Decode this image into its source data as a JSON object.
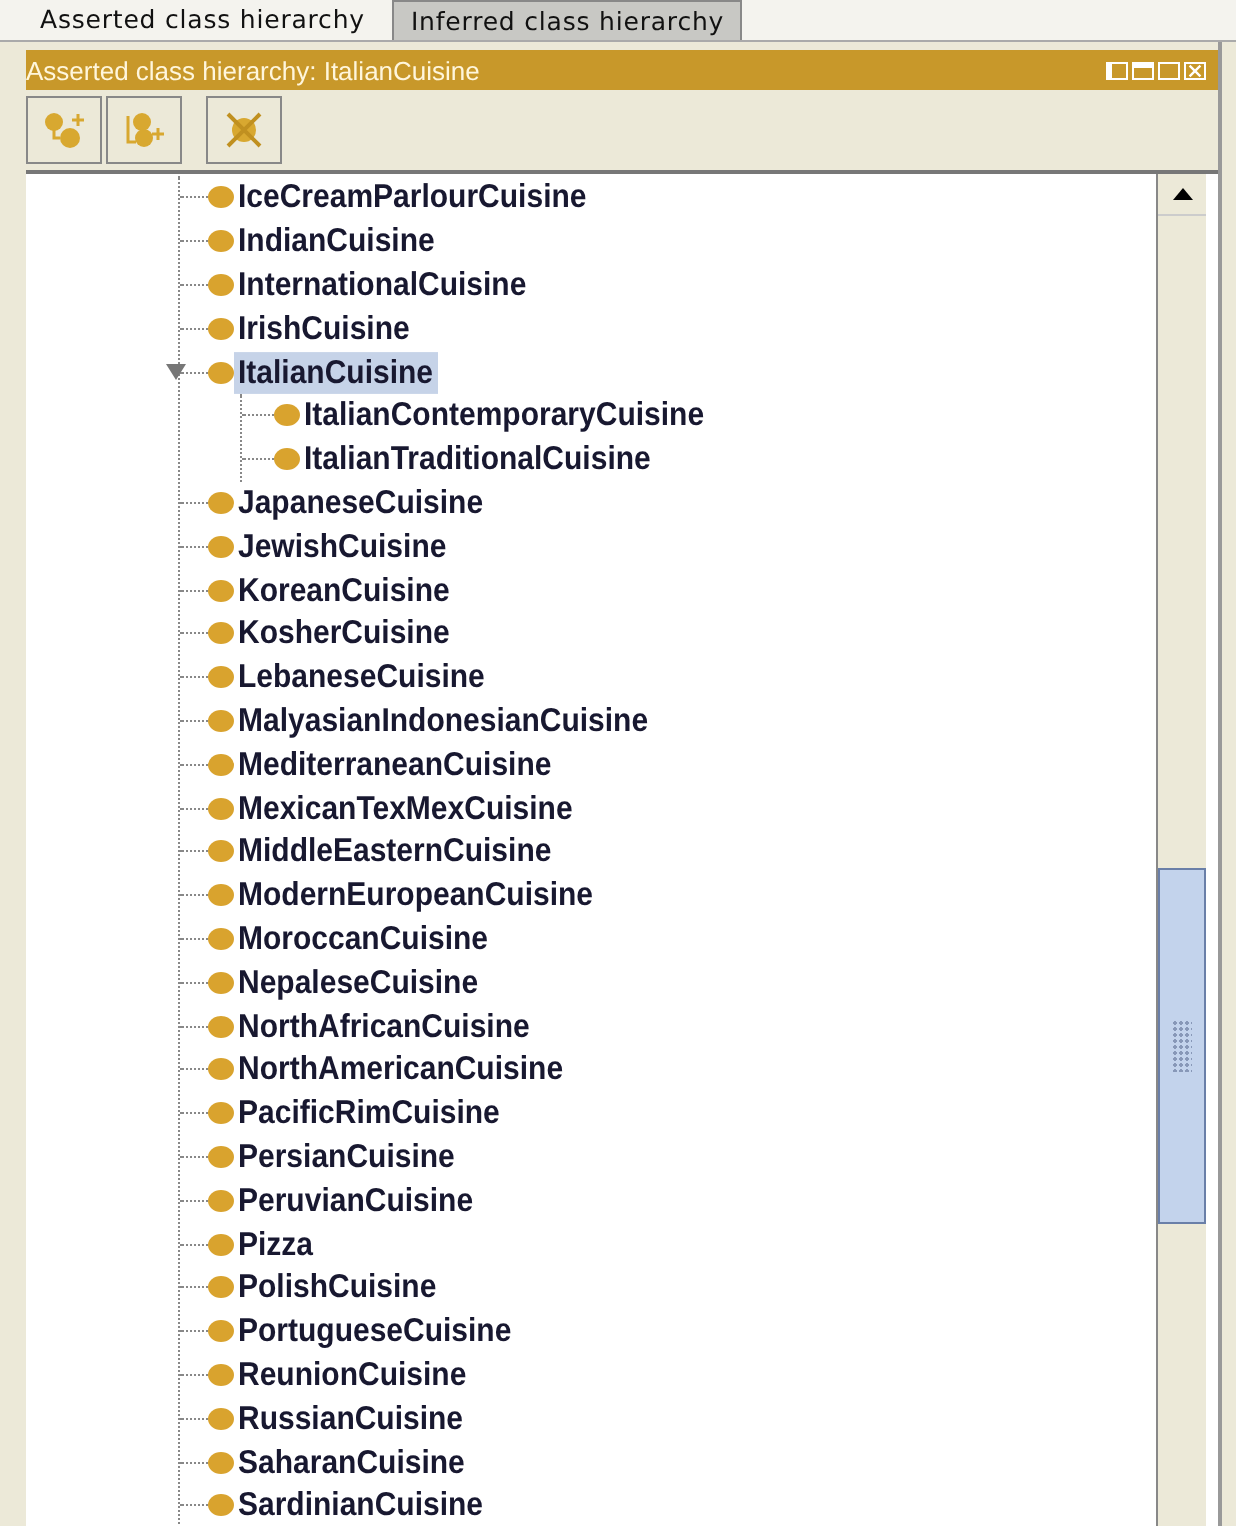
{
  "tabs": [
    {
      "label": "Asserted class hierarchy",
      "selected": true
    },
    {
      "label": "Inferred class hierarchy",
      "selected": false
    }
  ],
  "panel": {
    "title": "Asserted class hierarchy: ItalianCuisine"
  },
  "tree": [
    {
      "label": "IceCreamParlourCuisine",
      "selected": false
    },
    {
      "label": "IndianCuisine",
      "selected": false
    },
    {
      "label": "InternationalCuisine",
      "selected": false
    },
    {
      "label": "IrishCuisine",
      "selected": false
    },
    {
      "label": "ItalianCuisine",
      "selected": true,
      "expanded": true,
      "children": [
        {
          "label": "ItalianContemporaryCuisine",
          "selected": false
        },
        {
          "label": "ItalianTraditionalCuisine",
          "selected": false
        }
      ]
    },
    {
      "label": "JapaneseCuisine",
      "selected": false
    },
    {
      "label": "JewishCuisine",
      "selected": false
    },
    {
      "label": "KoreanCuisine",
      "selected": false
    },
    {
      "label": "KosherCuisine",
      "selected": false
    },
    {
      "label": "LebaneseCuisine",
      "selected": false
    },
    {
      "label": "MalyasianIndonesianCuisine",
      "selected": false
    },
    {
      "label": "MediterraneanCuisine",
      "selected": false
    },
    {
      "label": "MexicanTexMexCuisine",
      "selected": false
    },
    {
      "label": "MiddleEasternCuisine",
      "selected": false
    },
    {
      "label": "ModernEuropeanCuisine",
      "selected": false
    },
    {
      "label": "MoroccanCuisine",
      "selected": false
    },
    {
      "label": "NepaleseCuisine",
      "selected": false
    },
    {
      "label": "NorthAfricanCuisine",
      "selected": false
    },
    {
      "label": "NorthAmericanCuisine",
      "selected": false
    },
    {
      "label": "PacificRimCuisine",
      "selected": false
    },
    {
      "label": "PersianCuisine",
      "selected": false
    },
    {
      "label": "PeruvianCuisine",
      "selected": false
    },
    {
      "label": "Pizza",
      "selected": false
    },
    {
      "label": "PolishCuisine",
      "selected": false
    },
    {
      "label": "PortugueseCuisine",
      "selected": false
    },
    {
      "label": "ReunionCuisine",
      "selected": false
    },
    {
      "label": "RussianCuisine",
      "selected": false
    },
    {
      "label": "SaharanCuisine",
      "selected": false
    },
    {
      "label": "SardinianCuisine",
      "selected": false
    }
  ]
}
